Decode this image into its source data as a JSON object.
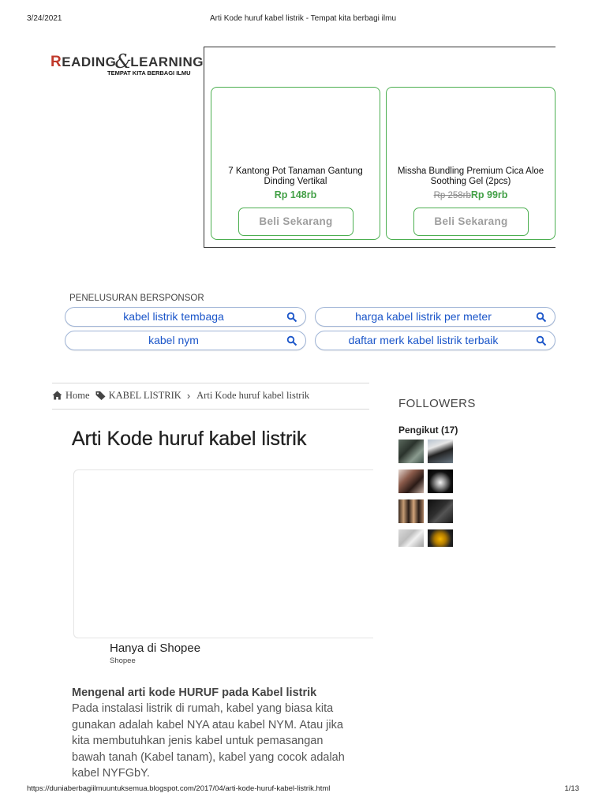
{
  "print": {
    "date": "3/24/2021",
    "doc_title": "Arti Kode huruf kabel listrik - Tempat kita berbagi ilmu",
    "url": "https://duniaberbagiilmuuntuksemua.blogspot.com/2017/04/arti-kode-huruf-kabel-listrik.html",
    "page": "1/13"
  },
  "logo": {
    "r_letter": "R",
    "eading": "EADING",
    "amp": "&",
    "l_letter": "L",
    "earning": "EARNING",
    "tagline": "TEMPAT KITA BERBAGI ILMU"
  },
  "ads": {
    "products": [
      {
        "name": "7 Kantong Pot Tanaman Gantung Dinding Vertikal",
        "old_price": "",
        "price": "Rp 148rb",
        "button": "Beli Sekarang"
      },
      {
        "name": "Missha Bundling Premium Cica Aloe Soothing Gel (2pcs)",
        "old_price": "Rp 258rb",
        "price": "Rp 99rb",
        "button": "Beli Sekarang"
      }
    ]
  },
  "sponsored": {
    "label": "PENELUSURAN BERSPONSOR",
    "queries": [
      "kabel listrik tembaga",
      "harga kabel listrik per meter",
      "kabel nym",
      "daftar merk kabel listrik terbaik"
    ]
  },
  "breadcrumb": {
    "home": "Home",
    "category": "KABEL LISTRIK",
    "current": "Arti Kode huruf kabel listrik"
  },
  "post": {
    "title": "Arti Kode huruf kabel listrik",
    "video_caption": "Hanya di Shopee",
    "video_source": "Shopee",
    "lead": "Mengenal arti kode HURUF pada Kabel listrik",
    "body": "Pada instalasi listrik di rumah, kabel yang biasa kita gunakan adalah kabel NYA atau kabel NYM. Atau jika kita membutuhkan jenis kabel untuk pemasangan bawah tanah (Kabel tanam), kabel yang cocok adalah kabel NYFGbY."
  },
  "sidebar": {
    "followers_title": "FOLLOWERS",
    "followers_count": "Pengikut (17)"
  },
  "colors": {
    "accent_green": "#43a047",
    "link_blue": "#1a55c9",
    "logo_red": "#c0392b"
  }
}
